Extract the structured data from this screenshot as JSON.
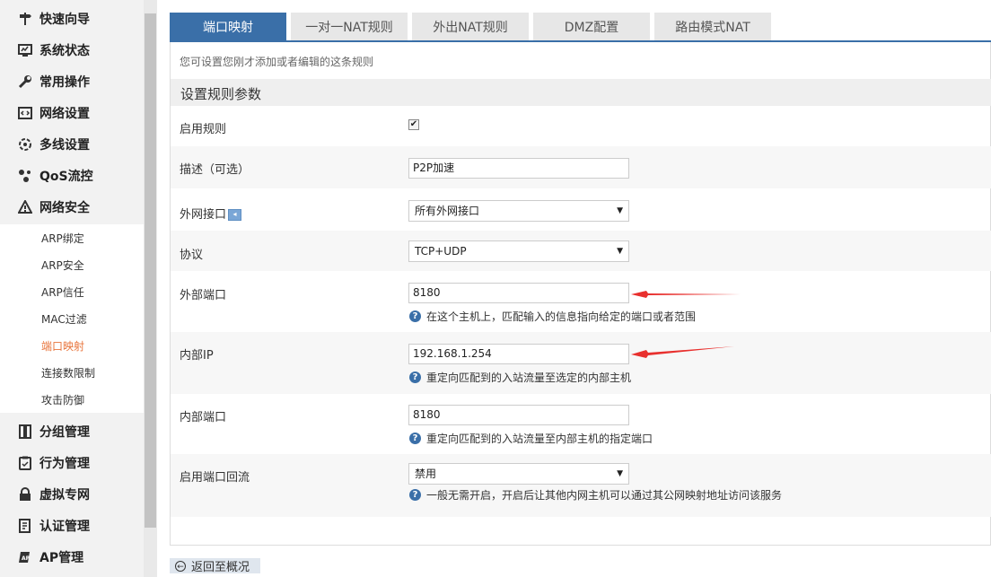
{
  "sidebar": {
    "top_items": [
      {
        "label": "快速向导",
        "icon": "signpost-icon"
      },
      {
        "label": "系统状态",
        "icon": "monitor-icon"
      },
      {
        "label": "常用操作",
        "icon": "wrench-icon"
      },
      {
        "label": "网络设置",
        "icon": "network-icon"
      },
      {
        "label": "多线设置",
        "icon": "multiline-icon"
      },
      {
        "label": "QoS流控",
        "icon": "qos-icon"
      },
      {
        "label": "网络安全",
        "icon": "warning-icon"
      }
    ],
    "sub_items": [
      "ARP绑定",
      "ARP安全",
      "ARP信任",
      "MAC过滤",
      "端口映射",
      "连接数限制",
      "攻击防御"
    ],
    "active_sub_item": "端口映射",
    "bottom_items": [
      {
        "label": "分组管理",
        "icon": "group-icon"
      },
      {
        "label": "行为管理",
        "icon": "behavior-icon"
      },
      {
        "label": "虚拟专网",
        "icon": "lock-icon"
      },
      {
        "label": "认证管理",
        "icon": "auth-icon"
      },
      {
        "label": "AP管理",
        "icon": "ap-icon"
      }
    ]
  },
  "tabs": [
    "端口映射",
    "一对一NAT规则",
    "外出NAT规则",
    "DMZ配置",
    "路由模式NAT"
  ],
  "active_tab": "端口映射",
  "hint": "您可设置您刚才添加或者编辑的这条规则",
  "section_title": "设置规则参数",
  "form": {
    "enable_rule": {
      "label": "启用规则",
      "checked": true
    },
    "description": {
      "label": "描述（可选）",
      "value": "P2P加速"
    },
    "wan_interface": {
      "label": "外网接口",
      "value": "所有外网接口"
    },
    "protocol": {
      "label": "协议",
      "value": "TCP+UDP"
    },
    "external_port": {
      "label": "外部端口",
      "value": "8180",
      "help": "在这个主机上，匹配输入的信息指向给定的端口或者范围"
    },
    "internal_ip": {
      "label": "内部IP",
      "value": "192.168.1.254",
      "help": "重定向匹配到的入站流量至选定的内部主机"
    },
    "internal_port": {
      "label": "内部端口",
      "value": "8180",
      "help": "重定向匹配到的入站流量至内部主机的指定端口"
    },
    "loopback": {
      "label": "启用端口回流",
      "value": "禁用",
      "help": "一般无需开启，开启后让其他内网主机可以通过其公网映射地址访问该服务"
    }
  },
  "back_button": "返回至概况",
  "colors": {
    "accent": "#3a6fa8",
    "active_sub": "#e8743b",
    "arrow": "#e8302e"
  }
}
